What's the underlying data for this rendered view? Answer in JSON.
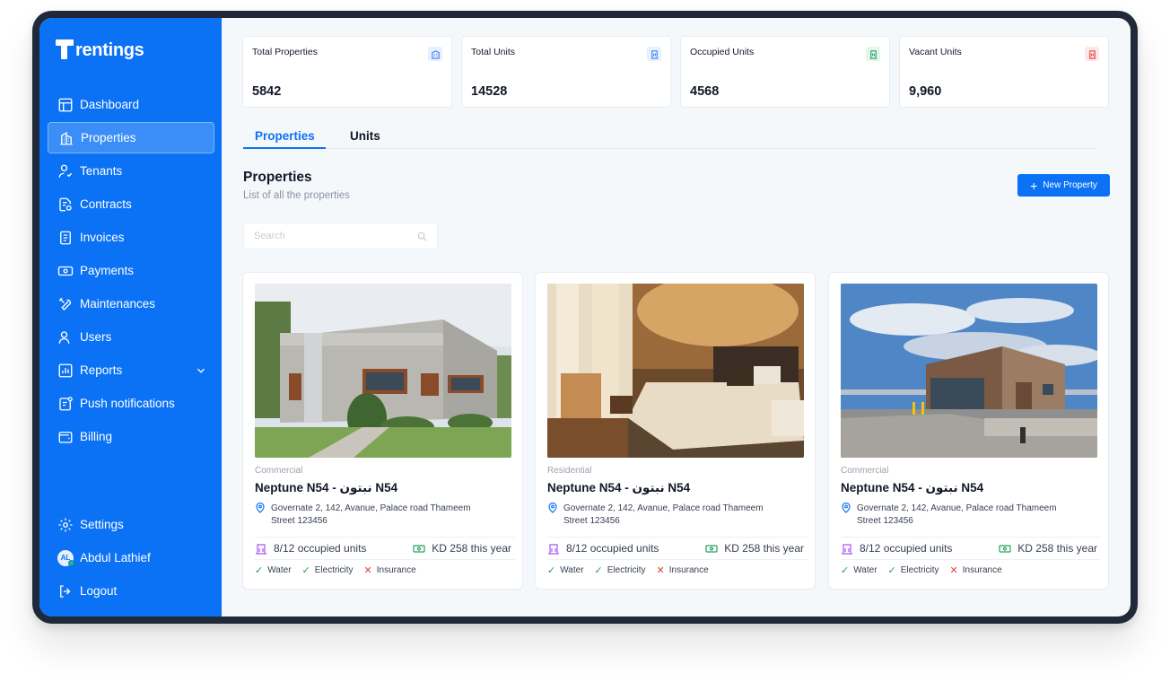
{
  "brand": {
    "name": "rentings"
  },
  "sidebar": {
    "items": [
      {
        "label": "Dashboard",
        "icon": "dashboard-icon"
      },
      {
        "label": "Properties",
        "icon": "building-icon",
        "active": true
      },
      {
        "label": "Tenants",
        "icon": "tenants-icon"
      },
      {
        "label": "Contracts",
        "icon": "contract-icon"
      },
      {
        "label": "Invoices",
        "icon": "invoice-icon"
      },
      {
        "label": "Payments",
        "icon": "payment-icon"
      },
      {
        "label": "Maintenances",
        "icon": "tools-icon"
      },
      {
        "label": "Users",
        "icon": "users-icon"
      },
      {
        "label": "Reports",
        "icon": "chart-icon"
      },
      {
        "label": "Push notifications",
        "icon": "notification-icon"
      },
      {
        "label": "Billing",
        "icon": "wallet-icon"
      }
    ],
    "bottom": {
      "settings": "Settings",
      "user_initials": "AL",
      "user_name": "Abdul Lathief",
      "logout": "Logout"
    }
  },
  "stats": [
    {
      "label": "Total Properties",
      "value": "5842",
      "color": "#3b82f6",
      "bg": "#e6f0fe"
    },
    {
      "label": "Total Units",
      "value": "14528",
      "color": "#3b82f6",
      "bg": "#e6f0fe"
    },
    {
      "label": "Occupied Units",
      "value": "4568",
      "color": "#22a060",
      "bg": "#e4f6ec"
    },
    {
      "label": "Vacant Units",
      "value": "9,960",
      "color": "#e0443b",
      "bg": "#fde8e7"
    }
  ],
  "tabs": {
    "properties": "Properties",
    "units": "Units"
  },
  "page": {
    "title": "Properties",
    "subtitle": "List of all the properties",
    "new_button": "New Property",
    "search_placeholder": "Search"
  },
  "cards": [
    {
      "type": "Commercial",
      "title": "Neptune N54 - نبتون N54",
      "address": "Governate 2, 142, Avanue, Palace road Thameem Street 123456",
      "occupied": "8/12 occupied units",
      "rent": "KD 258 this year",
      "utilities": {
        "water": "Water",
        "electricity": "Electricity",
        "insurance": "Insurance"
      }
    },
    {
      "type": "Residential",
      "title": "Neptune N54 - نبتون N54",
      "address": "Governate 2, 142, Avanue, Palace road Thameem Street 123456",
      "occupied": "8/12 occupied units",
      "rent": "KD 258 this year",
      "utilities": {
        "water": "Water",
        "electricity": "Electricity",
        "insurance": "Insurance"
      }
    },
    {
      "type": "Commercial",
      "title": "Neptune N54 - نبتون N54",
      "address": "Governate 2, 142, Avanue, Palace road Thameem Street 123456",
      "occupied": "8/12 occupied units",
      "rent": "KD 258 this year",
      "utilities": {
        "water": "Water",
        "electricity": "Electricity",
        "insurance": "Insurance"
      }
    }
  ],
  "colors": {
    "accent": "#0b72f6",
    "success": "#22a060",
    "danger": "#e0443b"
  }
}
